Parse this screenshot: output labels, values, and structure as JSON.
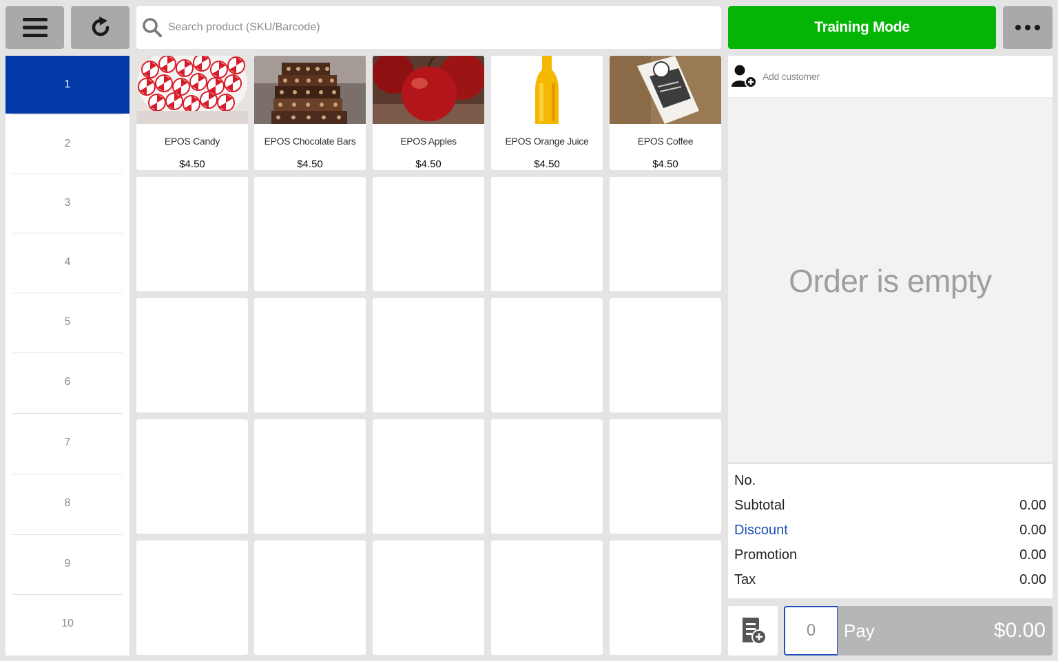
{
  "toolbar": {
    "menu_icon": "hamburger-menu-icon",
    "refresh_icon": "refresh-icon",
    "search_placeholder": "Search product (SKU/Barcode)",
    "search_value": "",
    "training_mode_label": "Training Mode",
    "more_icon": "more-dots-icon"
  },
  "categories": [
    "1",
    "2",
    "3",
    "4",
    "5",
    "6",
    "7",
    "8",
    "9",
    "10"
  ],
  "selected_category": "1",
  "products": [
    {
      "name": "EPOS Candy",
      "price": "$4.50",
      "image": "peppermint-candy"
    },
    {
      "name": "EPOS Chocolate Bars",
      "price": "$4.50",
      "image": "chocolate-bars"
    },
    {
      "name": "EPOS Apples",
      "price": "$4.50",
      "image": "apples"
    },
    {
      "name": "EPOS Orange Juice",
      "price": "$4.50",
      "image": "orange-juice-bottle"
    },
    {
      "name": "EPOS Coffee",
      "price": "$4.50",
      "image": "coffee-bag"
    }
  ],
  "order": {
    "add_customer_label": "Add customer",
    "empty_message": "Order is empty",
    "no_label": "No.",
    "subtotal_label": "Subtotal",
    "subtotal_value": "0.00",
    "discount_label": "Discount",
    "discount_value": "0.00",
    "promotion_label": "Promotion",
    "promotion_value": "0.00",
    "tax_label": "Tax",
    "tax_value": "0.00",
    "quantity": "0",
    "pay_label": "Pay",
    "pay_amount": "$0.00"
  },
  "colors": {
    "training_mode": "#05b505",
    "selected_category": "#0339a6",
    "discount_link": "#1d4db3",
    "pay_button": "#b6b6b6"
  }
}
